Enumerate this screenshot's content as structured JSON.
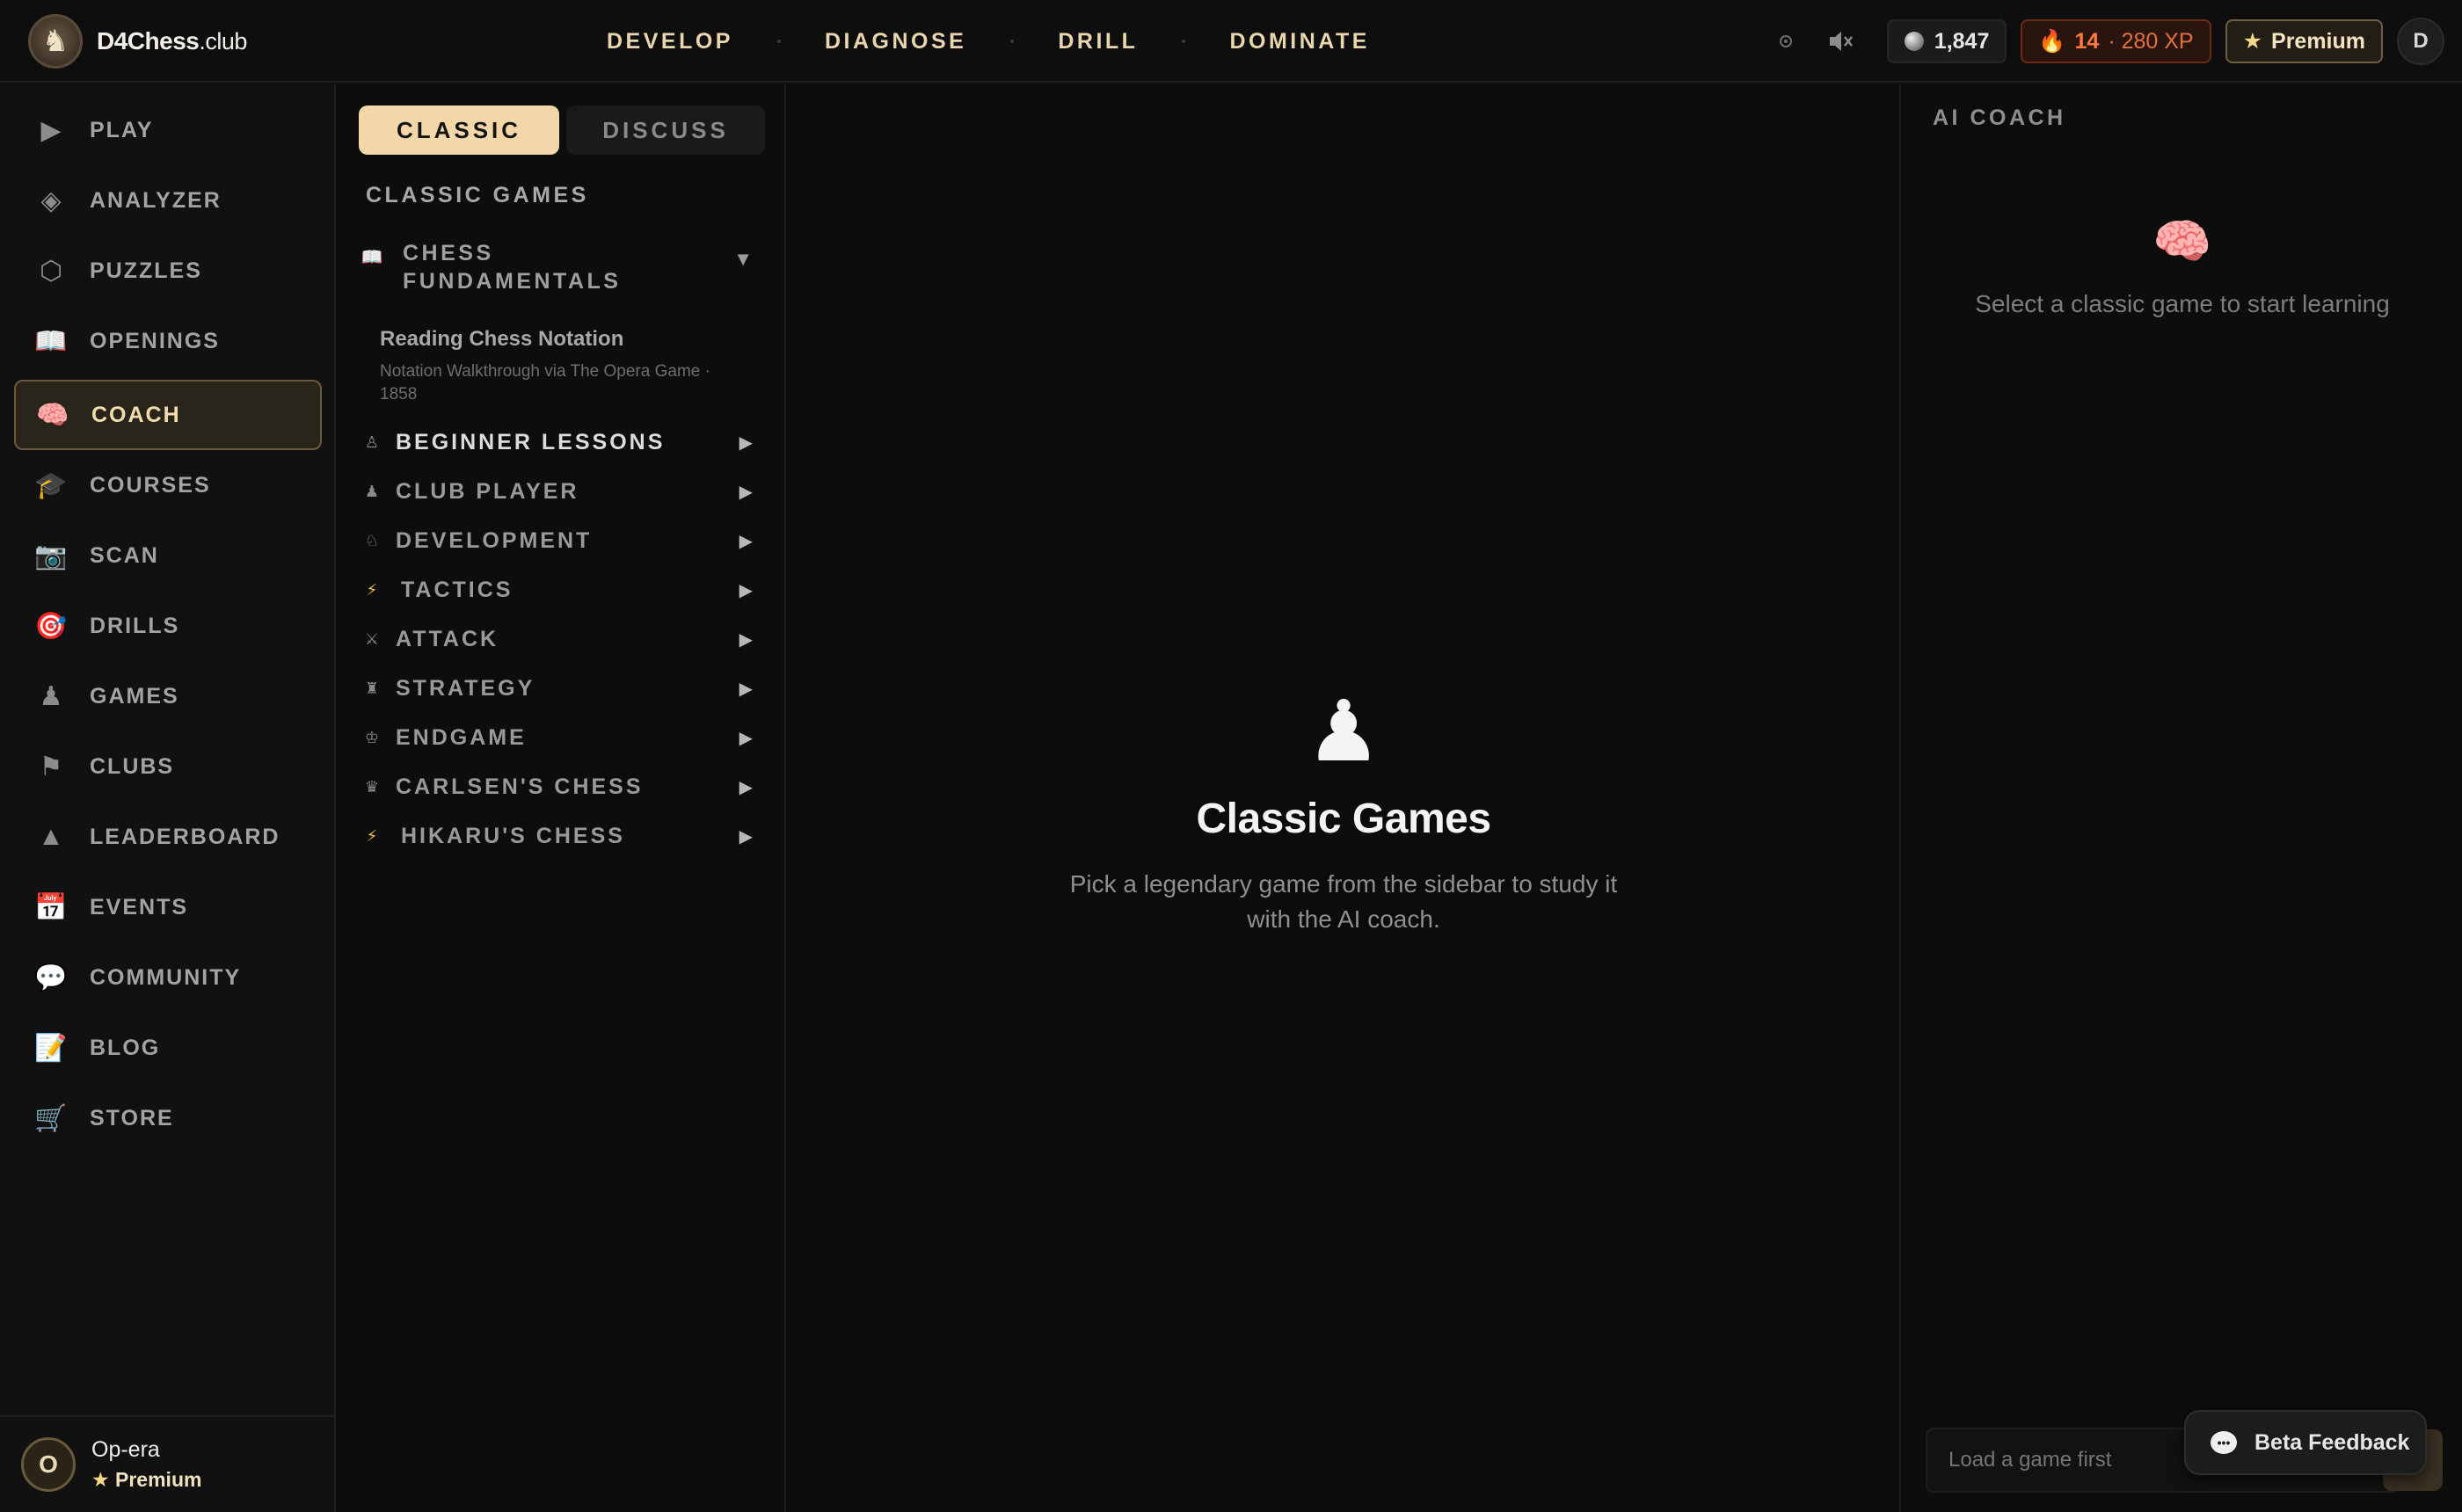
{
  "brand": {
    "logo_glyph": "♞",
    "name": "D4Chess",
    "tld": ".club"
  },
  "topnav": [
    "DEVELOP",
    "DIAGNOSE",
    "DRILL",
    "DOMINATE"
  ],
  "topbar": {
    "rating": "1,847",
    "streak": "14",
    "xp": "· 280 XP",
    "premium_label": "Premium",
    "user_initial": "D",
    "icons": [
      "settings-icon",
      "sound-muted-icon"
    ]
  },
  "sidebar": {
    "items": [
      {
        "label": "PLAY",
        "icon": "▶",
        "icon_name": "play-icon"
      },
      {
        "label": "ANALYZER",
        "icon": "◈",
        "icon_name": "analyzer-icon"
      },
      {
        "label": "PUZZLES",
        "icon": "⬡",
        "icon_name": "puzzle-icon"
      },
      {
        "label": "OPENINGS",
        "icon": "📖",
        "icon_name": "book-icon"
      },
      {
        "label": "COACH",
        "icon": "🧠",
        "icon_name": "brain-icon",
        "active": true
      },
      {
        "label": "COURSES",
        "icon": "🎓",
        "icon_name": "graduation-cap-icon"
      },
      {
        "label": "SCAN",
        "icon": "📷",
        "icon_name": "camera-icon"
      },
      {
        "label": "DRILLS",
        "icon": "🎯",
        "icon_name": "target-icon"
      },
      {
        "label": "GAMES",
        "icon": "♟",
        "icon_name": "pawn-icon"
      },
      {
        "label": "CLUBS",
        "icon": "⚑",
        "icon_name": "flag-icon"
      },
      {
        "label": "LEADERBOARD",
        "icon": "▲",
        "icon_name": "leaderboard-icon"
      },
      {
        "label": "EVENTS",
        "icon": "📅",
        "icon_name": "calendar-icon"
      },
      {
        "label": "COMMUNITY",
        "icon": "💬",
        "icon_name": "chat-bubble-icon"
      },
      {
        "label": "BLOG",
        "icon": "📝",
        "icon_name": "memo-icon"
      },
      {
        "label": "STORE",
        "icon": "🛒",
        "icon_name": "cart-icon"
      }
    ],
    "user": {
      "initial": "O",
      "name": "Op-era",
      "badge": "Premium"
    }
  },
  "panel": {
    "tabs": {
      "classic": "CLASSIC",
      "discuss": "DISCUSS"
    },
    "title": "CLASSIC GAMES",
    "open_category": {
      "label": "CHESS FUNDAMENTALS",
      "icon": "📖",
      "lesson_title": "Reading Chess Notation",
      "lesson_sub": "Notation Walkthrough via The Opera Game · 1858"
    },
    "categories": [
      {
        "label": "BEGINNER LESSONS",
        "icon": "♙",
        "bright": true
      },
      {
        "label": "CLUB PLAYER",
        "icon": "♟"
      },
      {
        "label": "DEVELOPMENT",
        "icon": "♘"
      },
      {
        "label": "TACTICS",
        "icon": "⚡"
      },
      {
        "label": "ATTACK",
        "icon": "⚔"
      },
      {
        "label": "STRATEGY",
        "icon": "♜"
      },
      {
        "label": "ENDGAME",
        "icon": "♔"
      },
      {
        "label": "CARLSEN'S CHESS",
        "icon": "♛"
      },
      {
        "label": "HIKARU'S CHESS",
        "icon": "⚡"
      }
    ]
  },
  "main": {
    "icon": "♟",
    "title": "Classic Games",
    "description": "Pick a legendary game from the sidebar to study it with the AI coach."
  },
  "coach": {
    "title": "AI COACH",
    "icon": "🧠",
    "message": "Select a classic game to start learning",
    "input_placeholder": "Load a game first",
    "feedback_label": "Beta Feedback"
  },
  "colors": {
    "accent": "#f3d7a8",
    "background": "#0c0c0c",
    "streak": "#ff7a3c",
    "premium_star": "#f5d68a"
  }
}
